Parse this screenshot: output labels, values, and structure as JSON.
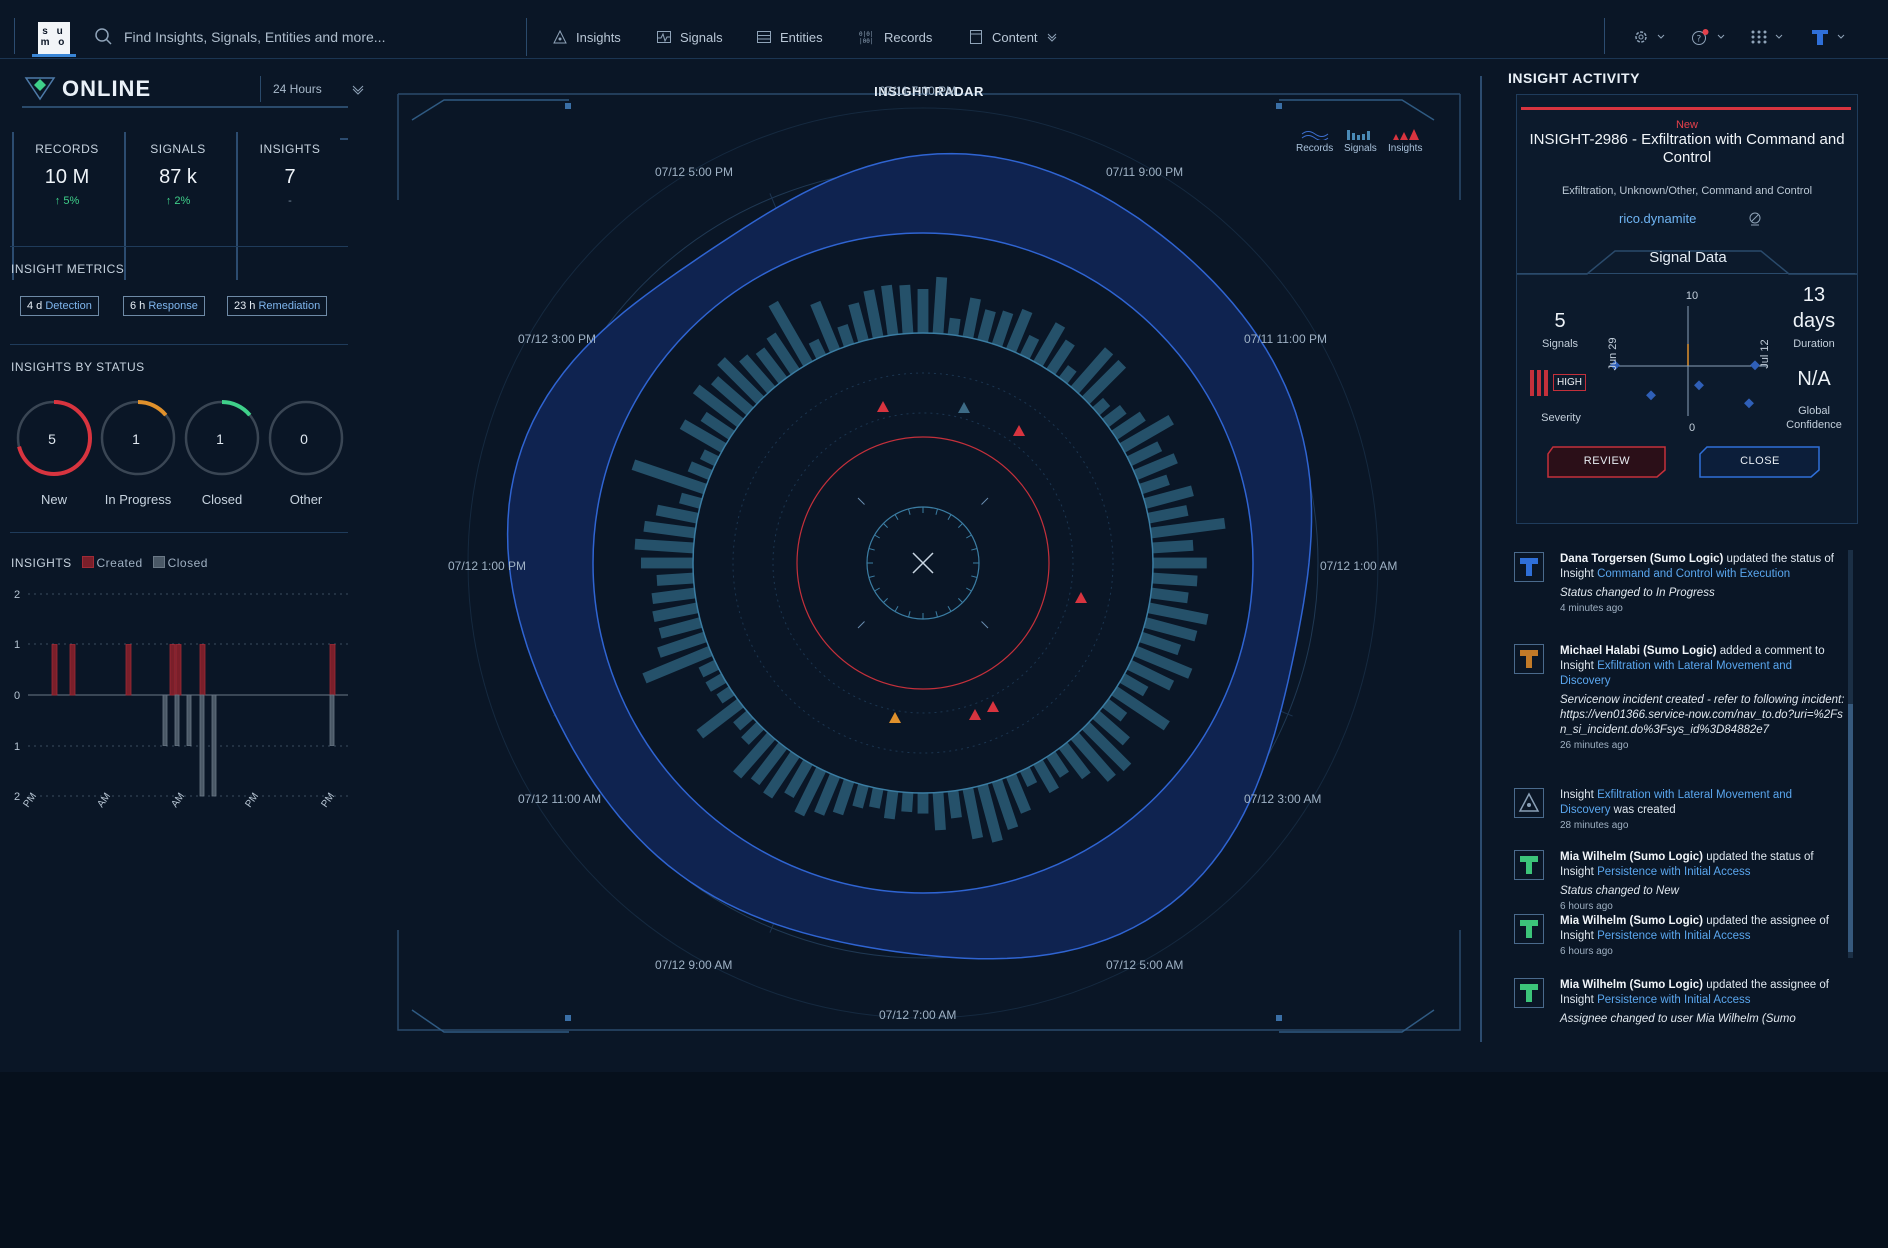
{
  "colors": {
    "accent": "#3a86d6",
    "danger": "#d8343f",
    "success": "#3fd08a",
    "warning": "#e0912c"
  },
  "topbar": {
    "logo_line1": "s u",
    "logo_line2": "m o",
    "search_placeholder": "Find Insights, Signals, Entities and more...",
    "nav": [
      {
        "label": "Insights",
        "icon": "insights-icon"
      },
      {
        "label": "Signals",
        "icon": "signals-icon"
      },
      {
        "label": "Entities",
        "icon": "entities-icon"
      },
      {
        "label": "Records",
        "icon": "records-icon"
      },
      {
        "label": "Content",
        "icon": "content-icon"
      }
    ]
  },
  "left": {
    "status": "ONLINE",
    "range": "24 Hours",
    "stats": [
      {
        "label": "RECORDS",
        "value": "10 M",
        "change": "5%"
      },
      {
        "label": "SIGNALS",
        "value": "87 k",
        "change": "2%"
      },
      {
        "label": "INSIGHTS",
        "value": "7",
        "change": "-"
      }
    ],
    "metrics_title": "INSIGHT METRICS",
    "metrics": [
      {
        "value": "4 d",
        "unit": "Detection"
      },
      {
        "value": "6 h",
        "unit": "Response"
      },
      {
        "value": "23 h",
        "unit": "Remediation"
      }
    ],
    "status_title": "INSIGHTS BY STATUS",
    "status_gauges": [
      {
        "value": "5",
        "label": "New",
        "fraction": 0.71,
        "color": "#d8343f"
      },
      {
        "value": "1",
        "label": "In Progress",
        "fraction": 0.14,
        "color": "#e0912c"
      },
      {
        "value": "1",
        "label": "Closed",
        "fraction": 0.14,
        "color": "#3fd08a"
      },
      {
        "value": "0",
        "label": "Other",
        "fraction": 0,
        "color": "#6a7a8a"
      }
    ],
    "insights_title": "INSIGHTS",
    "legend_created": "Created",
    "legend_closed": "Closed"
  },
  "chart_data": {
    "type": "bar",
    "title": "INSIGHTS",
    "y_ticks": [
      "2",
      "1",
      "0",
      "1",
      "2"
    ],
    "x_ticks": [
      "PM",
      "AM",
      "AM",
      "PM",
      "PM"
    ],
    "ylim": [
      -2,
      2
    ],
    "series": [
      {
        "name": "Created",
        "values": [
          1,
          1,
          1,
          1,
          1,
          1,
          1
        ],
        "color": "#7a1f2a"
      },
      {
        "name": "Closed",
        "values": [
          1,
          1,
          1,
          2,
          2,
          1
        ],
        "color": "#4a5866"
      }
    ]
  },
  "radar": {
    "title": "INSIGHT RADAR",
    "time_labels": [
      "07/11 7:00 PM",
      "07/11 9:00 PM",
      "07/11 11:00 PM",
      "07/12 1:00 AM",
      "07/12 3:00 AM",
      "07/12 5:00 AM",
      "07/12 7:00 AM",
      "07/12 9:00 AM",
      "07/12 11:00 AM",
      "07/12 1:00 PM",
      "07/12 3:00 PM",
      "07/12 5:00 PM"
    ],
    "legend": [
      "Records",
      "Signals",
      "Insights"
    ]
  },
  "right": {
    "title": "INSIGHT ACTIVITY",
    "card": {
      "new": "New",
      "title": "INSIGHT-2986 - Exfiltration with Command and Control",
      "tags": "Exfiltration, Unknown/Other, Command and Control",
      "user": "rico.dynamite",
      "signal_tab": "Signal Data",
      "signals_value": "5",
      "signals_label": "Signals",
      "severity_badge": "HIGH",
      "severity_label": "Severity",
      "duration_value": "13",
      "duration_unit": "days",
      "duration_label": "Duration",
      "confidence_value": "N/A",
      "confidence_label": "Global Confidence",
      "chart_top": "10",
      "chart_bottom": "0",
      "chart_left": "Jun 29",
      "chart_right": "Jul 12",
      "review": "REVIEW",
      "close": "CLOSE"
    },
    "feed": [
      {
        "avatar": "#2f6fd8",
        "name": "Dana Torgersen (Sumo Logic)",
        "action": " updated the status of Insight ",
        "link": "Command and Control with Execution",
        "after": "",
        "detail": "Status changed to In Progress",
        "ago": "4 minutes ago"
      },
      {
        "avatar": "#c27a28",
        "name": "Michael Halabi (Sumo Logic)",
        "action": " added a comment to Insight ",
        "link": "Exfiltration with Lateral Movement and Discovery",
        "after": "",
        "detail": "Servicenow incident created - refer to following incident: https://ven01366.service-now.com/nav_to.do?uri=%2Fsn_si_incident.do%3Fsys_id%3D84882e7",
        "ago": "26 minutes ago"
      },
      {
        "avatar": "#8aa0b7",
        "name": "",
        "action": "Insight ",
        "link": "Exfiltration with Lateral Movement and Discovery",
        "after": " was created",
        "detail": "",
        "ago": "28 minutes ago"
      },
      {
        "avatar": "#3cc47a",
        "name": "Mia Wilhelm (Sumo Logic)",
        "action": " updated the status of Insight ",
        "link": "Persistence with Initial Access",
        "after": "",
        "detail": "Status changed to New",
        "ago": "6 hours ago"
      },
      {
        "avatar": "#3cc47a",
        "name": "Mia Wilhelm (Sumo Logic)",
        "action": " updated the assignee of Insight ",
        "link": "Persistence with Initial Access",
        "after": "",
        "detail": "",
        "ago": "6 hours ago"
      },
      {
        "avatar": "#3cc47a",
        "name": "Mia Wilhelm (Sumo Logic)",
        "action": " updated the assignee of Insight ",
        "link": "Persistence with Initial Access",
        "after": "",
        "detail": "Assignee changed to user Mia Wilhelm (Sumo",
        "ago": ""
      }
    ]
  }
}
